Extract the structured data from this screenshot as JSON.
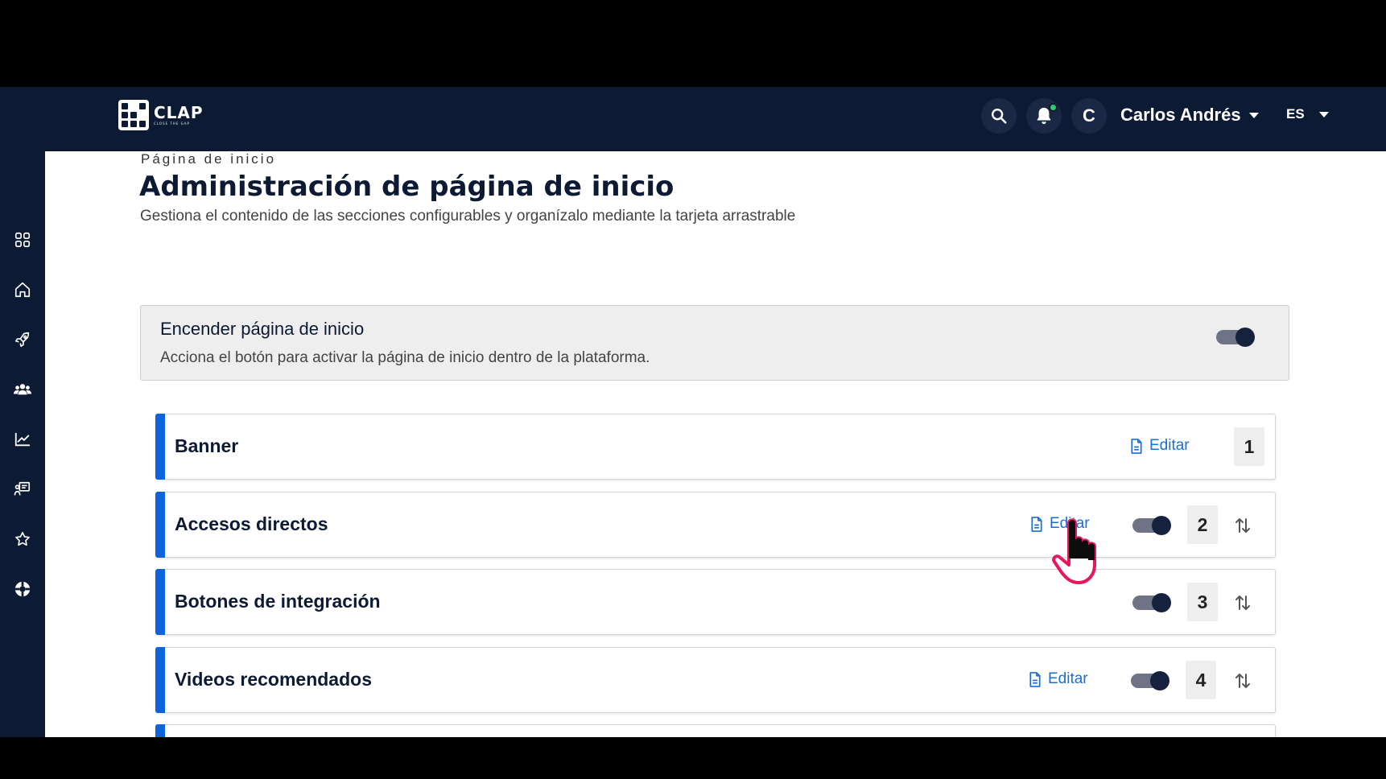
{
  "header": {
    "logo_text": "CLAP",
    "logo_tagline": "CLOSE THE GAP",
    "avatar_initial": "C",
    "user_name": "Carlos Andrés",
    "language": "ES"
  },
  "sidebar": {
    "items": [
      {
        "icon": "grid-icon"
      },
      {
        "icon": "home-icon"
      },
      {
        "icon": "rocket-icon"
      },
      {
        "icon": "users-icon"
      },
      {
        "icon": "chart-icon"
      },
      {
        "icon": "presentation-icon"
      },
      {
        "icon": "star-icon"
      },
      {
        "icon": "support-icon"
      }
    ]
  },
  "page": {
    "breadcrumb": "Página de inicio",
    "title": "Administración de página de inicio",
    "subtitle": "Gestiona el contenido de las secciones configurables y organízalo mediante la tarjeta arrastrable"
  },
  "power": {
    "title": "Encender página de inicio",
    "description": "Acciona el botón para activar la página de inicio dentro de la plataforma.",
    "enabled": true
  },
  "sections": [
    {
      "title": "Banner",
      "edit_label": "Editar",
      "order": "1"
    },
    {
      "title": "Accesos directos",
      "edit_label": "Editar",
      "order": "2",
      "enabled": true
    },
    {
      "title": "Botones de integración",
      "order": "3",
      "enabled": true
    },
    {
      "title": "Videos recomendados",
      "edit_label": "Editar",
      "order": "4",
      "enabled": true
    }
  ],
  "colors": {
    "navy": "#0c1a33",
    "accent_blue": "#0d63d9",
    "link_blue": "#1a6fd1",
    "notification_dot": "#2ecc71",
    "cursor_pink": "#e8175d"
  }
}
